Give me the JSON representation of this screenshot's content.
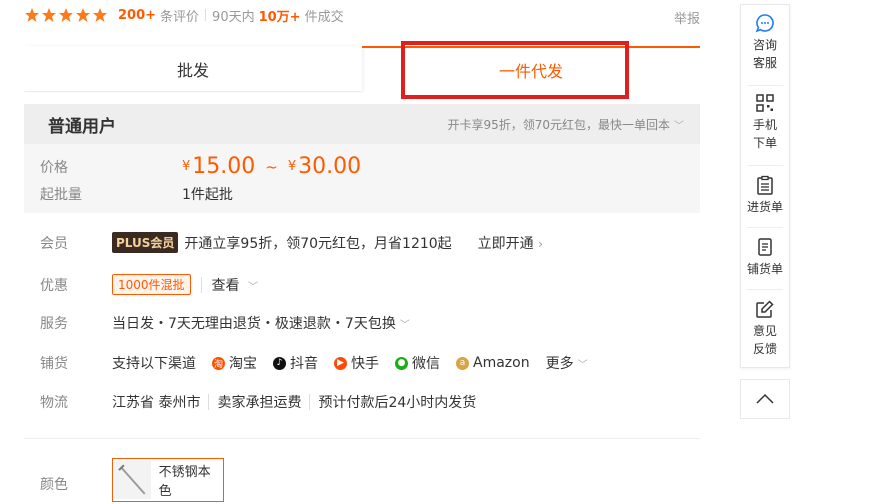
{
  "rating": {
    "stars": 5,
    "review_count": "200+",
    "review_label": "条评价",
    "period_label": "90天内",
    "sold_count": "10万+",
    "sold_label": "件成交",
    "report": "举报"
  },
  "tabs": {
    "wholesale": "批发",
    "dropship": "一件代发"
  },
  "price_panel": {
    "user_type": "普通用户",
    "card_offer": "开卡享95折，领70元红包，最快一单回本",
    "price_label": "价格",
    "currency": "¥",
    "price_min": "15.00",
    "price_sep": "~",
    "price_max": "30.00",
    "moq_label": "起批量",
    "moq_value": "1件起批"
  },
  "member": {
    "label": "会员",
    "badge": "PLUS会员",
    "text": "开通立享95折，领70元红包，月省1210起",
    "action": "立即开通"
  },
  "discount": {
    "label": "优惠",
    "tag": "1000件混批",
    "action": "查看"
  },
  "service": {
    "label": "服务",
    "text": "当日发・7天无理由退货・极速退款・7天包换"
  },
  "channels": {
    "label": "铺货",
    "intro": "支持以下渠道",
    "items": [
      {
        "name": "淘宝",
        "icon": "taobao-icon",
        "color": "#ff5000"
      },
      {
        "name": "抖音",
        "icon": "douyin-icon",
        "color": "#111111"
      },
      {
        "name": "快手",
        "icon": "kuaishou-icon",
        "color": "#ff4906"
      },
      {
        "name": "微信",
        "icon": "wechat-icon",
        "color": "#1aad19"
      },
      {
        "name": "Amazon",
        "icon": "amazon-icon",
        "color": "#d9a441"
      }
    ],
    "more": "更多"
  },
  "logistics": {
    "label": "物流",
    "origin": "江苏省 泰州市",
    "shipping": "卖家承担运费",
    "dispatch": "预计付款后24小时内发货"
  },
  "color": {
    "label": "颜色",
    "option": "不锈钢本色"
  },
  "sidebar": {
    "service": "咨询客服",
    "mobile": "手机下单",
    "purchase": "进货单",
    "listing": "铺货单",
    "feedback": "意见反馈"
  },
  "colors": {
    "accent": "#ff5a00",
    "highlight": "#e02020"
  }
}
